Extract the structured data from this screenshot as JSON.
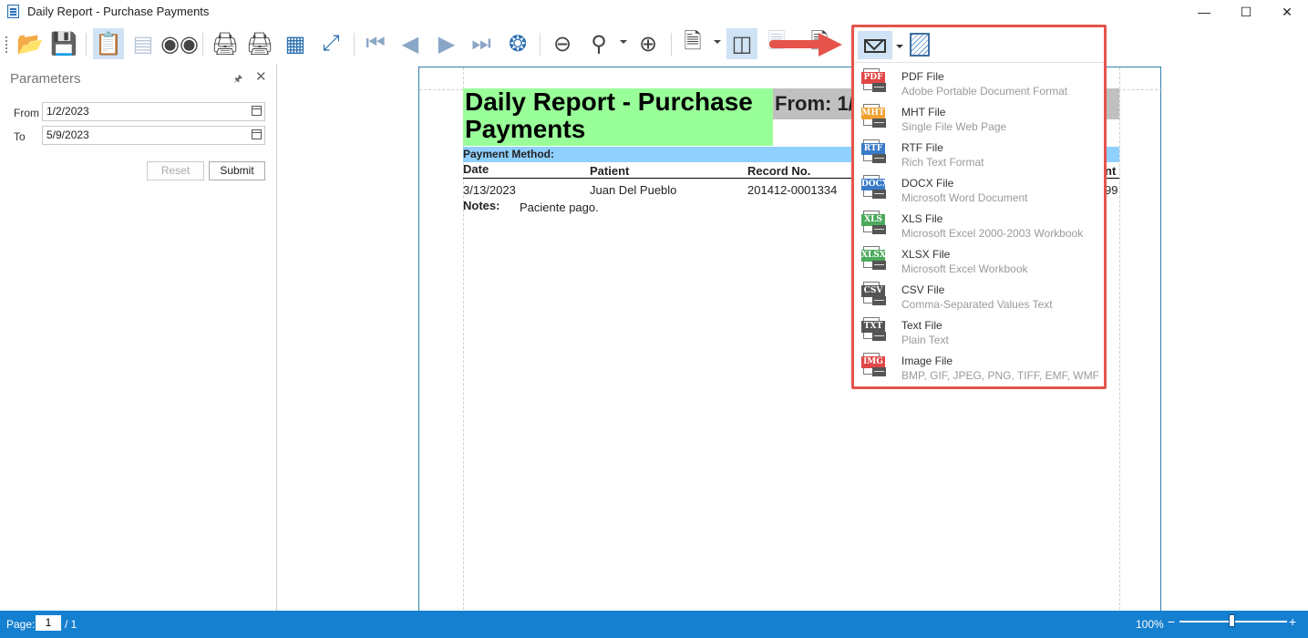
{
  "window": {
    "title": "Daily Report - Purchase Payments",
    "minimize": "—",
    "maximize": "☐",
    "close": "✕"
  },
  "toolbar_icons": [
    "open-icon",
    "save-icon",
    "parameters-icon",
    "editing-fields-icon",
    "search-icon",
    "print-icon",
    "quick-print-icon",
    "page-setup-icon",
    "scale-icon",
    "first-page-icon",
    "previous-page-icon",
    "next-page-icon",
    "last-page-icon",
    "navigation-icon",
    "zoom-out-icon",
    "zoom-icon",
    "zoom-in-icon",
    "single-page-icon",
    "multiple-pages-icon",
    "watermark-icon",
    "export-icon",
    "send-email-icon",
    "hatch-icon"
  ],
  "parameters": {
    "title": "Parameters",
    "pin": "🖈",
    "close": "✕",
    "from_label": "From",
    "from_value": "1/2/2023",
    "to_label": "To",
    "to_value": "5/9/2023",
    "reset": "Reset",
    "submit": "Submit"
  },
  "report": {
    "title": "Daily Report - Purchase Payments",
    "from": "From: 1/",
    "payment_method": "Payment Method:",
    "columns": [
      "Date",
      "Patient",
      "Record No.",
      "nt"
    ],
    "row": {
      "date": "3/13/2023",
      "patient": "Juan Del Pueblo",
      "record": "201412-0001334",
      "amount": "99"
    },
    "notes_label": "Notes:",
    "notes_value": "Paciente pago."
  },
  "export_menu": {
    "items": [
      {
        "badge": "PDF",
        "color": "#e04646",
        "name": "PDF File",
        "desc": "Adobe Portable Document Format"
      },
      {
        "badge": "MHT",
        "color": "#f0a030",
        "name": "MHT File",
        "desc": "Single File Web Page"
      },
      {
        "badge": "RTF",
        "color": "#3a7bc8",
        "name": "RTF File",
        "desc": "Rich Text Format"
      },
      {
        "badge": "DOCX",
        "color": "#3a7bc8",
        "name": "DOCX File",
        "desc": "Microsoft Word Document"
      },
      {
        "badge": "XLS",
        "color": "#4caa5c",
        "name": "XLS File",
        "desc": "Microsoft Excel 2000-2003 Workbook"
      },
      {
        "badge": "XLSX",
        "color": "#4caa5c",
        "name": "XLSX File",
        "desc": "Microsoft Excel Workbook"
      },
      {
        "badge": "CSV",
        "color": "#555555",
        "name": "CSV File",
        "desc": "Comma-Separated Values Text"
      },
      {
        "badge": "TXT",
        "color": "#555555",
        "name": "Text File",
        "desc": "Plain Text"
      },
      {
        "badge": "IMG",
        "color": "#e04646",
        "name": "Image File",
        "desc": "BMP, GIF, JPEG, PNG, TIFF, EMF, WMF"
      }
    ]
  },
  "status": {
    "page_label": "Page:",
    "page": "1",
    "total": "/ 1",
    "zoom": "100%",
    "zoom_level": 0.5,
    "minus": "−",
    "plus": "+"
  },
  "colors": {
    "accent": "#1680d0",
    "highlight": "#e5544b",
    "title_bg": "#99ff99",
    "method_bg": "#8fd0ff",
    "from_bg": "#c0c0c0"
  }
}
